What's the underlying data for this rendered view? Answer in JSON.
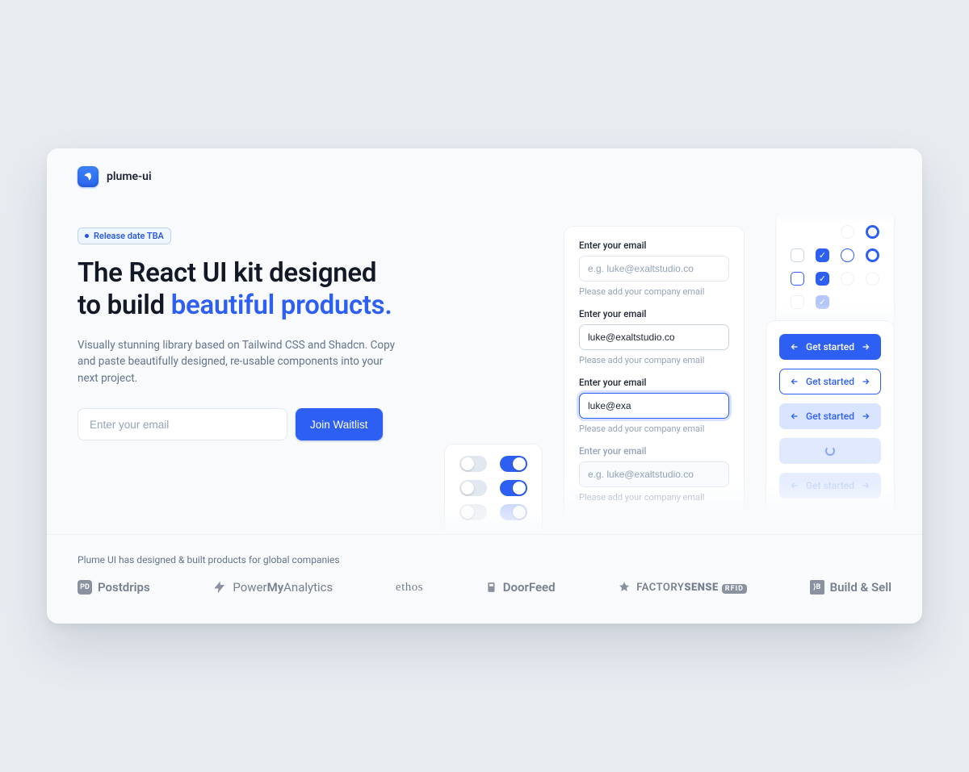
{
  "brand": {
    "name": "plume-ui"
  },
  "tag": "Release date TBA",
  "headline": {
    "line1": "The React UI kit designed",
    "line2_pre": "to build ",
    "line2_accent": "beautiful products."
  },
  "sub": "Visually stunning library based on Tailwind CSS and Shadcn. Copy and paste beautifully designed, re-usable components into your next project.",
  "signup": {
    "placeholder": "Enter your email",
    "button": "Join Waitlist"
  },
  "preview_inputs": {
    "label": "Enter your email",
    "placeholder": "e.g. luke@exaltstudio.co",
    "helper": "Please add your company email",
    "value_filled": "luke@exaltstudio.co",
    "value_typing": "luke@exa"
  },
  "preview_buttons": {
    "label": "Get started"
  },
  "footer": {
    "caption": "Plume UI has designed & built products for global companies",
    "logos": {
      "postdrips": "Postdrips",
      "pma": "PowerMyAnalytics",
      "ethos": "ethos",
      "doorfeed": "DoorFeed",
      "factory_pre": "FACTORY",
      "factory_post": "SENSE",
      "factory_badge": "RFID",
      "buildsell": "Build & Sell"
    }
  }
}
